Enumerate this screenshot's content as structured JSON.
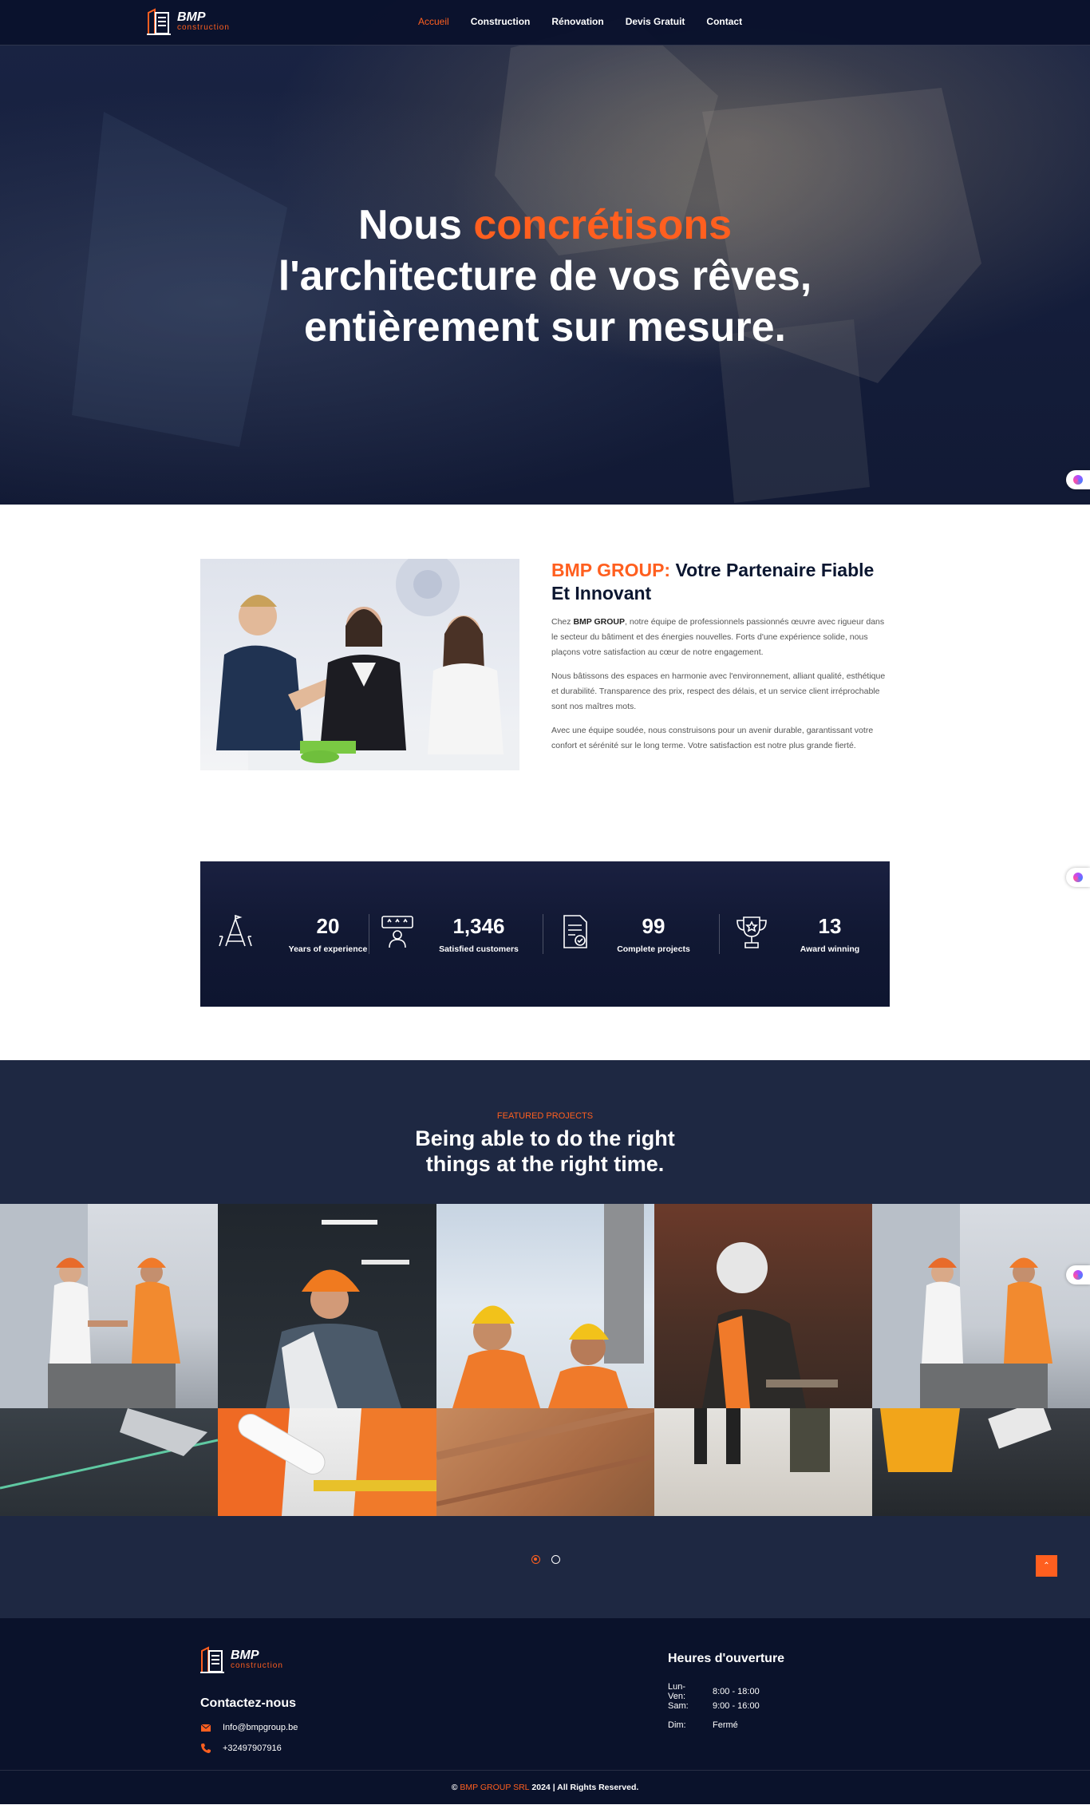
{
  "nav": {
    "logo": {
      "brand": "BMP",
      "sub": "construction"
    },
    "items": [
      {
        "label": "Accueil",
        "active": true
      },
      {
        "label": "Construction"
      },
      {
        "label": "Rénovation"
      },
      {
        "label": "Devis Gratuit"
      },
      {
        "label": "Contact"
      }
    ]
  },
  "hero": {
    "line1_a": "Nous ",
    "line1_b": "concrétisons",
    "line2": "l'architecture de vos rêves,",
    "line3": "entièrement sur mesure."
  },
  "about": {
    "title_a": "BMP GROUP:",
    "title_b": " Votre Partenaire Fiable Et Innovant",
    "p1_a": "Chez ",
    "p1_b": "BMP GROUP",
    "p1_c": ", notre équipe de professionnels passionnés œuvre avec rigueur dans le secteur du bâtiment et des énergies nouvelles. Forts d'une expérience solide, nous plaçons votre satisfaction au cœur de notre engagement.",
    "p2": "Nous bâtissons des espaces en harmonie avec l'environnement, alliant qualité, esthétique et durabilité. Transparence des prix, respect des délais, et un service client irréprochable sont nos maîtres mots.",
    "p3": "Avec une équipe soudée, nous construisons pour un avenir durable, garantissant votre confort et sérénité sur le long terme. Votre satisfaction est notre plus grande fierté."
  },
  "stats": [
    {
      "icon": "tower-icon",
      "value": "20",
      "label": "Years of experience"
    },
    {
      "icon": "customer-rating-icon",
      "value": "1,346",
      "label": "Satisfied customers"
    },
    {
      "icon": "project-document-icon",
      "value": "99",
      "label": "Complete projects"
    },
    {
      "icon": "trophy-icon",
      "value": "13",
      "label": "Award winning"
    }
  ],
  "projects": {
    "kicker": "FEATURED PROJECTS",
    "title": "Being able to do the right things at the right time.",
    "carousel_pages": 2,
    "active_page": 1
  },
  "footer": {
    "logo": {
      "brand": "BMP",
      "sub": "construction"
    },
    "contact_title": "Contactez-nous",
    "email": "Info@bmpgroup.be",
    "phone": "+32497907916",
    "hours_title": "Heures d'ouverture",
    "hours": [
      {
        "day": "Lun-Ven:",
        "time": "8:00 - 18:00"
      },
      {
        "day": "Sam:",
        "time": "9:00 - 16:00"
      },
      {
        "day": "Dim:",
        "time": "Fermé"
      }
    ],
    "copyright_a": "© ",
    "copyright_b": "BMP GROUP SRL",
    "copyright_c": " 2024 | All Rights Reserved."
  },
  "colors": {
    "accent": "#ff5f1f",
    "navy": "#0b1630",
    "section": "#1e2842"
  }
}
